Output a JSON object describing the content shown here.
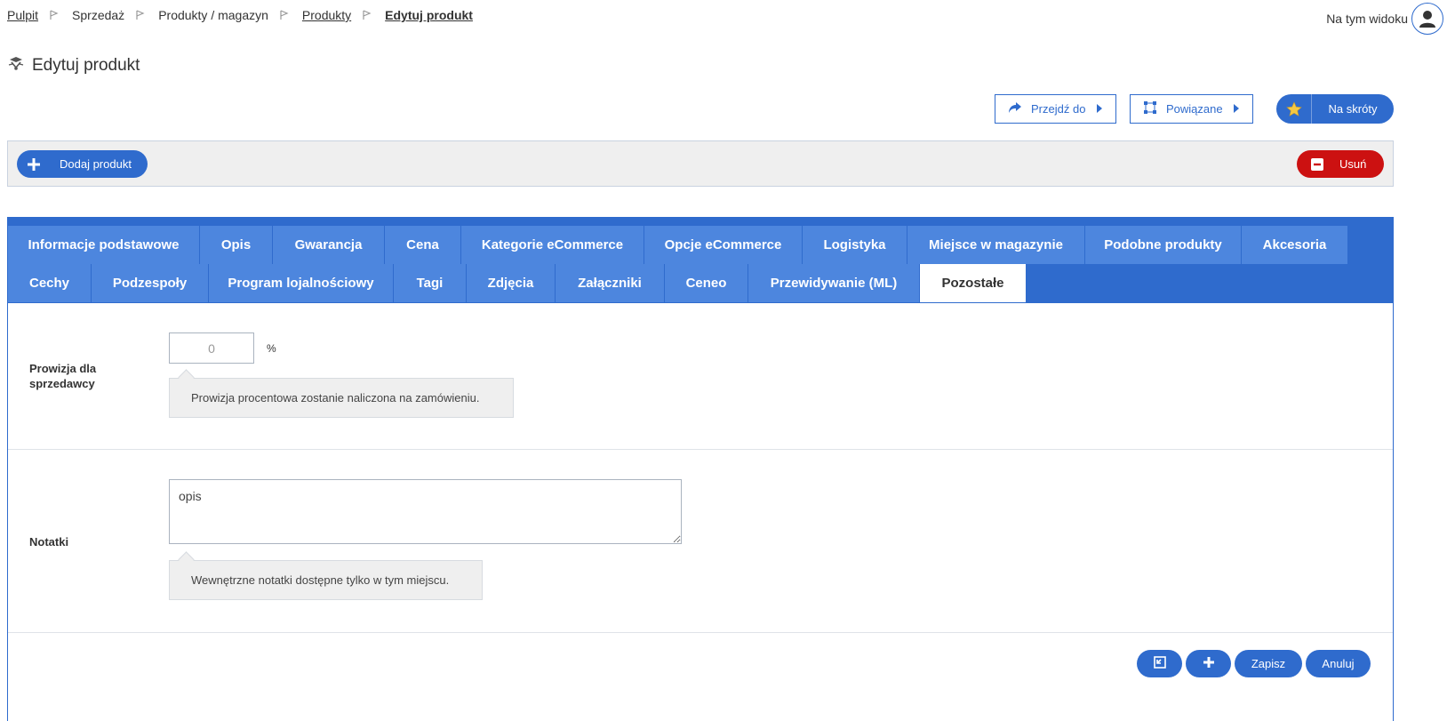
{
  "breadcrumb": {
    "items": [
      {
        "label": "Pulpit"
      },
      {
        "label": "Sprzedaż"
      },
      {
        "label": "Produkty / magazyn"
      },
      {
        "label": "Produkty"
      },
      {
        "label": "Edytuj produkt"
      }
    ]
  },
  "header": {
    "view_label": "Na tym widoku",
    "title": "Edytuj produkt"
  },
  "actions": {
    "goto_label": "Przejdź do",
    "related_label": "Powiązane",
    "shortcuts_label": "Na skróty"
  },
  "toolbar": {
    "add_label": "Dodaj produkt",
    "delete_label": "Usuń"
  },
  "tabs": {
    "row1": [
      "Informacje podstawowe",
      "Opis",
      "Gwarancja",
      "Cena",
      "Kategorie eCommerce",
      "Opcje eCommerce",
      "Logistyka",
      "Miejsce w magazynie",
      "Podobne produkty",
      "Akcesoria"
    ],
    "row2": [
      "Cechy",
      "Podzespoły",
      "Program lojalnościowy",
      "Tagi",
      "Zdjęcia",
      "Załączniki",
      "Ceneo",
      "Przewidywanie (ML)",
      "Pozostałe"
    ],
    "active": "Pozostałe"
  },
  "form": {
    "commission": {
      "label": "Prowizja dla sprzedawcy",
      "value": "0",
      "unit": "%",
      "hint": "Prowizja procentowa zostanie naliczona na zamówieniu."
    },
    "notes": {
      "label": "Notatki",
      "value": "opis",
      "hint": "Wewnętrzne notatki dostępne tylko w tym miejscu."
    }
  },
  "footer": {
    "save_label": "Zapisz",
    "cancel_label": "Anuluj"
  },
  "colors": {
    "primary": "#2f6bcd",
    "tab": "#4d86de",
    "danger": "#cc1111"
  }
}
